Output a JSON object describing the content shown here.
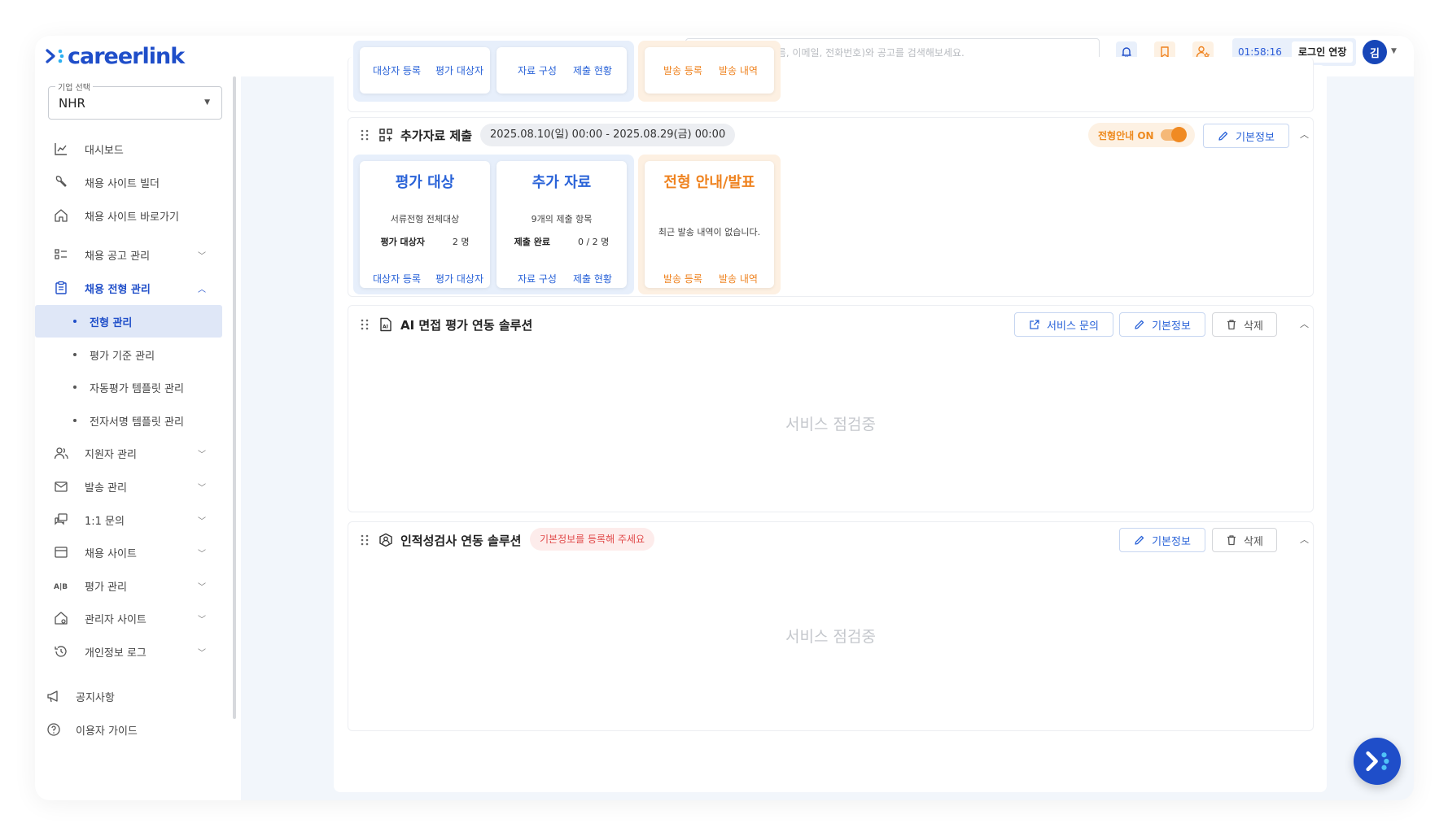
{
  "header": {
    "logo": "careerlink",
    "search_placeholder": "모든 지원자(이름, 이메일, 전화번호)와 공고를 검색해보세요.",
    "timer": "01:58:16",
    "extend_label": "로그인 연장",
    "avatar_initial": "김"
  },
  "sidebar": {
    "company_label": "기업 선택",
    "company_value": "NHR",
    "items": [
      {
        "label": "대시보드"
      },
      {
        "label": "채용 사이트 빌더"
      },
      {
        "label": "채용 사이트 바로가기"
      },
      {
        "label": "채용 공고 관리"
      },
      {
        "label": "채용 전형 관리"
      },
      {
        "label": "지원자 관리"
      },
      {
        "label": "발송 관리"
      },
      {
        "label": "1:1 문의"
      },
      {
        "label": "채용 사이트"
      },
      {
        "label": "평가 관리"
      },
      {
        "label": "관리자 사이트"
      },
      {
        "label": "개인정보 로그"
      }
    ],
    "sub_items": [
      {
        "label": "전형 관리"
      },
      {
        "label": "평가 기준 관리"
      },
      {
        "label": "자동평가 템플릿 관리"
      },
      {
        "label": "전자서명 템플릿 관리"
      }
    ],
    "bottom": [
      {
        "label": "공지사항"
      },
      {
        "label": "이용자 가이드"
      }
    ]
  },
  "top_section": {
    "links": [
      "대상자 등록",
      "평가 대상자",
      "자료 구성",
      "제출 현황",
      "발송 등록",
      "발송 내역"
    ]
  },
  "additional": {
    "title": "추가자료 제출",
    "date_range": "2025.08.10(일) 00:00 - 2025.08.29(금) 00:00",
    "toggle_label": "전형안내 ON",
    "edit_label": "기본정보",
    "card1": {
      "title": "평가 대상",
      "sub": "서류전형 전체대상",
      "row_label": "평가 대상자",
      "row_value": "2 명",
      "link1": "대상자 등록",
      "link2": "평가 대상자"
    },
    "card2": {
      "title": "추가 자료",
      "sub": "9개의 제출 항목",
      "row_label": "제출 완료",
      "row_value": "0 / 2 명",
      "link1": "자료 구성",
      "link2": "제출 현황"
    },
    "card3": {
      "title": "전형 안내/발표",
      "sub": "최근 발송 내역이 없습니다.",
      "link1": "발송 등록",
      "link2": "발송 내역"
    }
  },
  "ai_section": {
    "title": "AI 면접 평가 연동 솔루션",
    "service_label": "서비스 문의",
    "edit_label": "기본정보",
    "delete_label": "삭제",
    "maintenance": "서비스 점검중"
  },
  "personality_section": {
    "title": "인적성검사 연동 솔루션",
    "warning": "기본정보를 등록해 주세요",
    "edit_label": "기본정보",
    "delete_label": "삭제",
    "maintenance": "서비스 점검중"
  },
  "colors": {
    "primary": "#1f4ec9",
    "orange": "#ef8320",
    "warn": "#e14b4b"
  }
}
